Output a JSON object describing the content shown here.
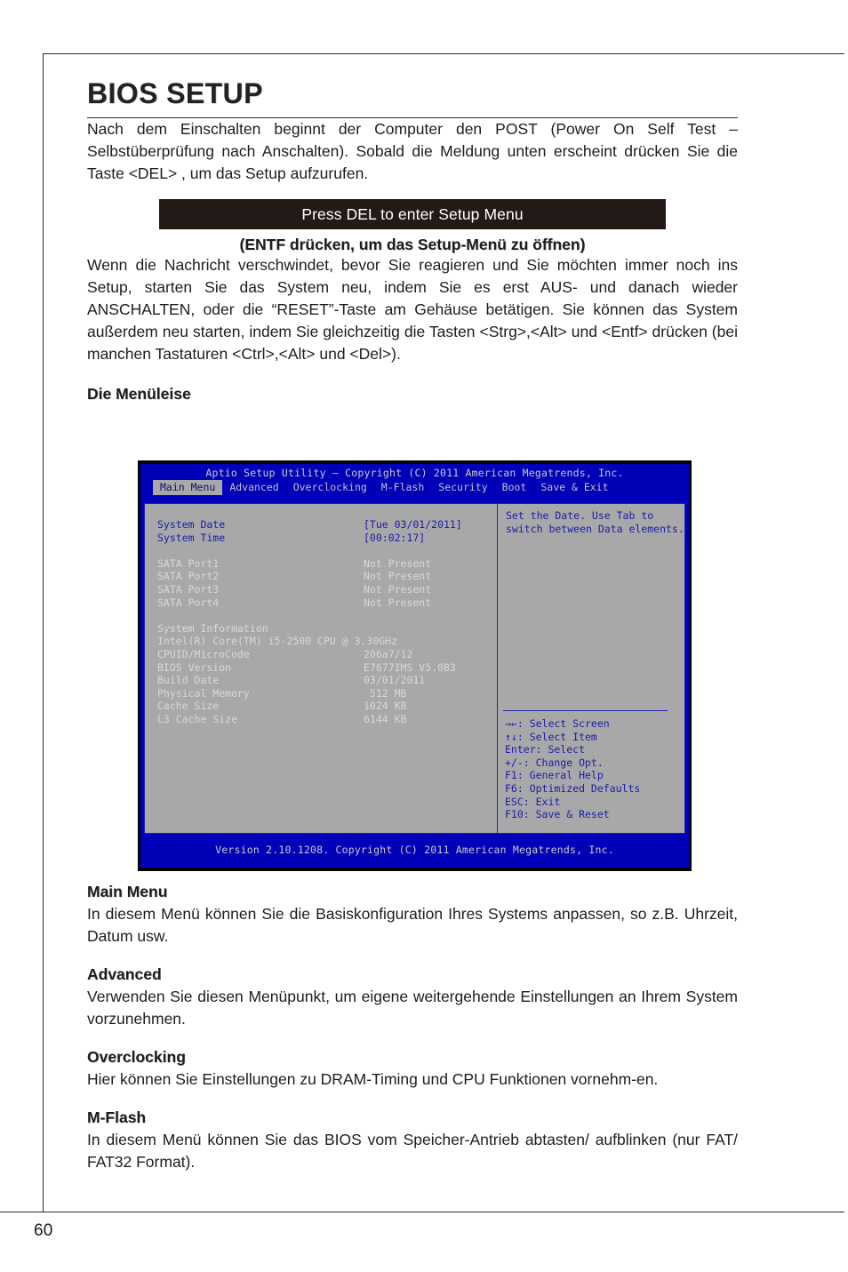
{
  "page": {
    "number": "60",
    "title": "BIOS SETUP"
  },
  "intro": {
    "paragraph": "Nach dem Einschalten beginnt der Computer den POST (Power On Self Test – Selbstüberprüfung nach Anschalten). Sobald die Meldung unten erscheint drücken Sie die Taste <DEL> , um das Setup aufzurufen."
  },
  "banner": {
    "message": "Press DEL to enter Setup Menu",
    "caption": "(ENTF drücken, um das Setup-Menü zu öffnen)",
    "background": "#231a18",
    "text_color": "#ffffff"
  },
  "second_paragraph": "Wenn die Nachricht verschwindet, bevor Sie reagieren und Sie möchten immer noch ins Setup, starten Sie das System neu, indem Sie es erst AUS- und danach wieder ANSCHALTEN, oder die “RESET”-Taste am Gehäuse betätigen. Sie können das System außerdem neu starten, indem Sie gleichzeitig die Tasten <Strg>,<Alt> und <Entf> drücken (bei manchen Tastaturen <Ctrl>,<Alt> und <Del>).",
  "menu_bar_heading": "Die Menüleise",
  "bios": {
    "title": "Aptio Setup Utility – Copyright (C) 2011 American Megatrends, Inc.",
    "footer": "Version 2.10.1208. Copyright (C) 2011 American Megatrends, Inc.",
    "tabs": [
      {
        "label": "Main Menu",
        "active": true
      },
      {
        "label": "Advanced",
        "active": false
      },
      {
        "label": "Overclocking",
        "active": false
      },
      {
        "label": "M-Flash",
        "active": false
      },
      {
        "label": "Security",
        "active": false
      },
      {
        "label": "Boot",
        "active": false
      },
      {
        "label": "Save & Exit",
        "active": false
      }
    ],
    "datetime": [
      {
        "label": "System Date",
        "value": "[Tue 03/01/2011]"
      },
      {
        "label": "System Time",
        "value": "[00:02:17]"
      }
    ],
    "sata": [
      {
        "label": "SATA Port1",
        "value": "Not Present"
      },
      {
        "label": "SATA Port2",
        "value": "Not Present"
      },
      {
        "label": "SATA Port3",
        "value": "Not Present"
      },
      {
        "label": "SATA Port4",
        "value": "Not Present"
      }
    ],
    "system_information": {
      "heading": "System Information",
      "cpu": "Intel(R) Core(TM) i5-2500 CPU @ 3.30GHz",
      "rows": [
        {
          "label": "CPUID/MicroCode",
          "value": "206a7/12"
        },
        {
          "label": "BIOS Version",
          "value": "E7677IMS V5.0B3"
        },
        {
          "label": "Build Date",
          "value": "03/01/2011"
        },
        {
          "label": "Physical Memory",
          "value": " 512 MB"
        },
        {
          "label": "Cache Size",
          "value": "1024 KB"
        },
        {
          "label": "L3 Cache Size",
          "value": "6144 KB"
        }
      ]
    },
    "help": {
      "line1": "Set the Date. Use Tab to",
      "line2": "switch between Data elements."
    },
    "legend": [
      "→←: Select Screen",
      "↑↓: Select Item",
      "Enter: Select",
      "+/-: Change Opt.",
      "F1: General Help",
      "F6: Optimized Defaults",
      "ESC: Exit",
      "F10: Save & Reset"
    ],
    "colors": {
      "chrome_blue": "#0000b8",
      "panel_gray": "#a8a8a8",
      "accent_blue": "#1c1ca8",
      "dim_text": "#d8d8d8"
    }
  },
  "sections": [
    {
      "heading": "Main Menu",
      "body": "In diesem Menü können Sie die Basiskonfiguration Ihres Systems anpassen, so z.B. Uhrzeit, Datum usw."
    },
    {
      "heading": "Advanced",
      "body": "Verwenden Sie diesen Menüpunkt, um eigene weitergehende Einstellungen an Ihrem System vorzunehmen."
    },
    {
      "heading": "Overclocking",
      "body": "Hier können Sie Einstellungen zu DRAM-Timing und CPU Funktionen vornehm-en."
    },
    {
      "heading": "M-Flash",
      "body": "In diesem Menü können Sie das BIOS vom Speicher-Antrieb abtasten/ aufblinken (nur FAT/ FAT32 Format)."
    }
  ]
}
